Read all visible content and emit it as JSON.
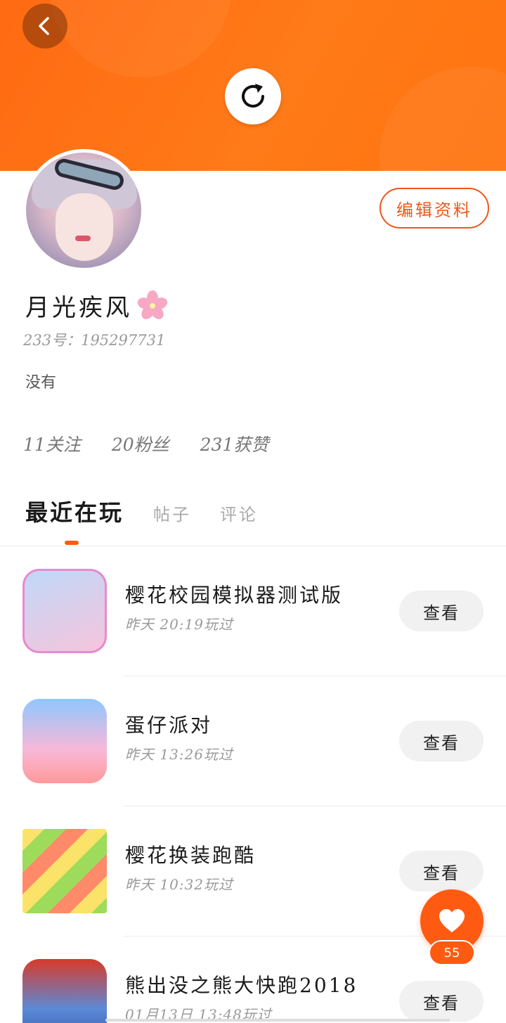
{
  "profile": {
    "nickname": "月光疾风",
    "uid": "233号：195297731",
    "bio": "没有",
    "edit_label": "编辑资料"
  },
  "stats": [
    {
      "value": "11",
      "label": "关注"
    },
    {
      "value": "20",
      "label": "粉丝"
    },
    {
      "value": "231",
      "label": "获赞"
    }
  ],
  "tabs": [
    {
      "label": "最近在玩",
      "active": true
    },
    {
      "label": "帖子",
      "active": false
    },
    {
      "label": "评论",
      "active": false
    }
  ],
  "games": [
    {
      "name": "樱花校园模拟器测试版",
      "played": "昨天 20:19玩过",
      "action": "查看"
    },
    {
      "name": "蛋仔派对",
      "played": "昨天 13:26玩过",
      "action": "查看"
    },
    {
      "name": "樱花换装跑酷",
      "played": "昨天 10:32玩过",
      "action": "查看"
    },
    {
      "name": "熊出没之熊大快跑2018",
      "played": "01月13日 13:48玩过",
      "action": "查看"
    }
  ],
  "like": {
    "count": "55"
  },
  "colors": {
    "accent": "#ff5a12",
    "header": "#ff7a18"
  },
  "icons": [
    "back-arrow-icon",
    "refresh-icon",
    "heart-icon",
    "cherry-blossom-icon"
  ]
}
